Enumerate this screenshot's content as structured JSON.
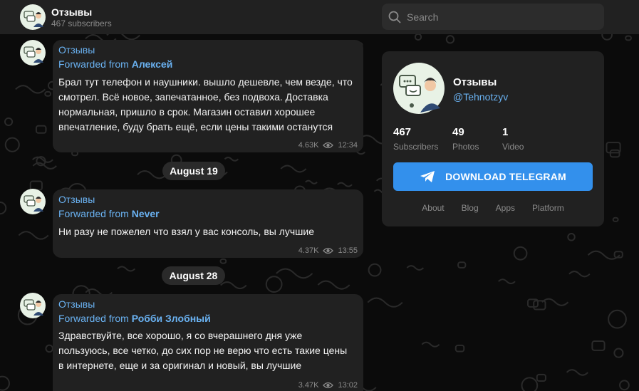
{
  "channel": {
    "title": "Отзывы",
    "subscribers_line": "467 subscribers",
    "handle": "@Tehnotzyv"
  },
  "search": {
    "placeholder": "Search"
  },
  "messages": [
    {
      "author": "Отзывы",
      "forwarded_prefix": "Forwarded from ",
      "forwarded_from": "Алексей",
      "text_lines": [
        "Брал тут телефон и наушники. вышло дешевле, чем везде, что",
        "смотрел. Всё новое, запечатанное, без подвоха. Доставка",
        "нормальная, пришло в срок. Магазин оставил хорошее",
        "впечатление, буду брать ещё, если цены такими останутся"
      ],
      "views": "4.63K",
      "time": "12:34"
    },
    {
      "author": "Отзывы",
      "forwarded_prefix": "Forwarded from ",
      "forwarded_from": "Never",
      "text_lines": [
        "Ни разу не пожелел что взял у вас консоль, вы лучшие"
      ],
      "views": "4.37K",
      "time": "13:55"
    },
    {
      "author": "Отзывы",
      "forwarded_prefix": "Forwarded from ",
      "forwarded_from": "Робби Злобный",
      "text_lines": [
        "Здравствуйте, все хорошо, я со вчерашнего дня уже",
        "пользуюсь, все четко, до сих пор не верю что есть такие цены",
        "в интернете, еще и за оригинал и новый, вы лучшие"
      ],
      "views": "3.47K",
      "time": "13:02"
    }
  ],
  "date_separators": [
    "August 19",
    "August 28"
  ],
  "stats": [
    {
      "value": "467",
      "label": "Subscribers"
    },
    {
      "value": "49",
      "label": "Photos"
    },
    {
      "value": "1",
      "label": "Video"
    }
  ],
  "download_button": "DOWNLOAD TELEGRAM",
  "footer_links": [
    "About",
    "Blog",
    "Apps",
    "Platform"
  ],
  "colors": {
    "accent": "#3390ec",
    "link": "#6ab2f2",
    "panel": "#212121",
    "background": "#0b0b0b"
  },
  "icons": {
    "search": "search-icon",
    "views": "eye-icon",
    "download": "telegram-plane-icon",
    "avatar": "chat-support-avatar-icon"
  }
}
